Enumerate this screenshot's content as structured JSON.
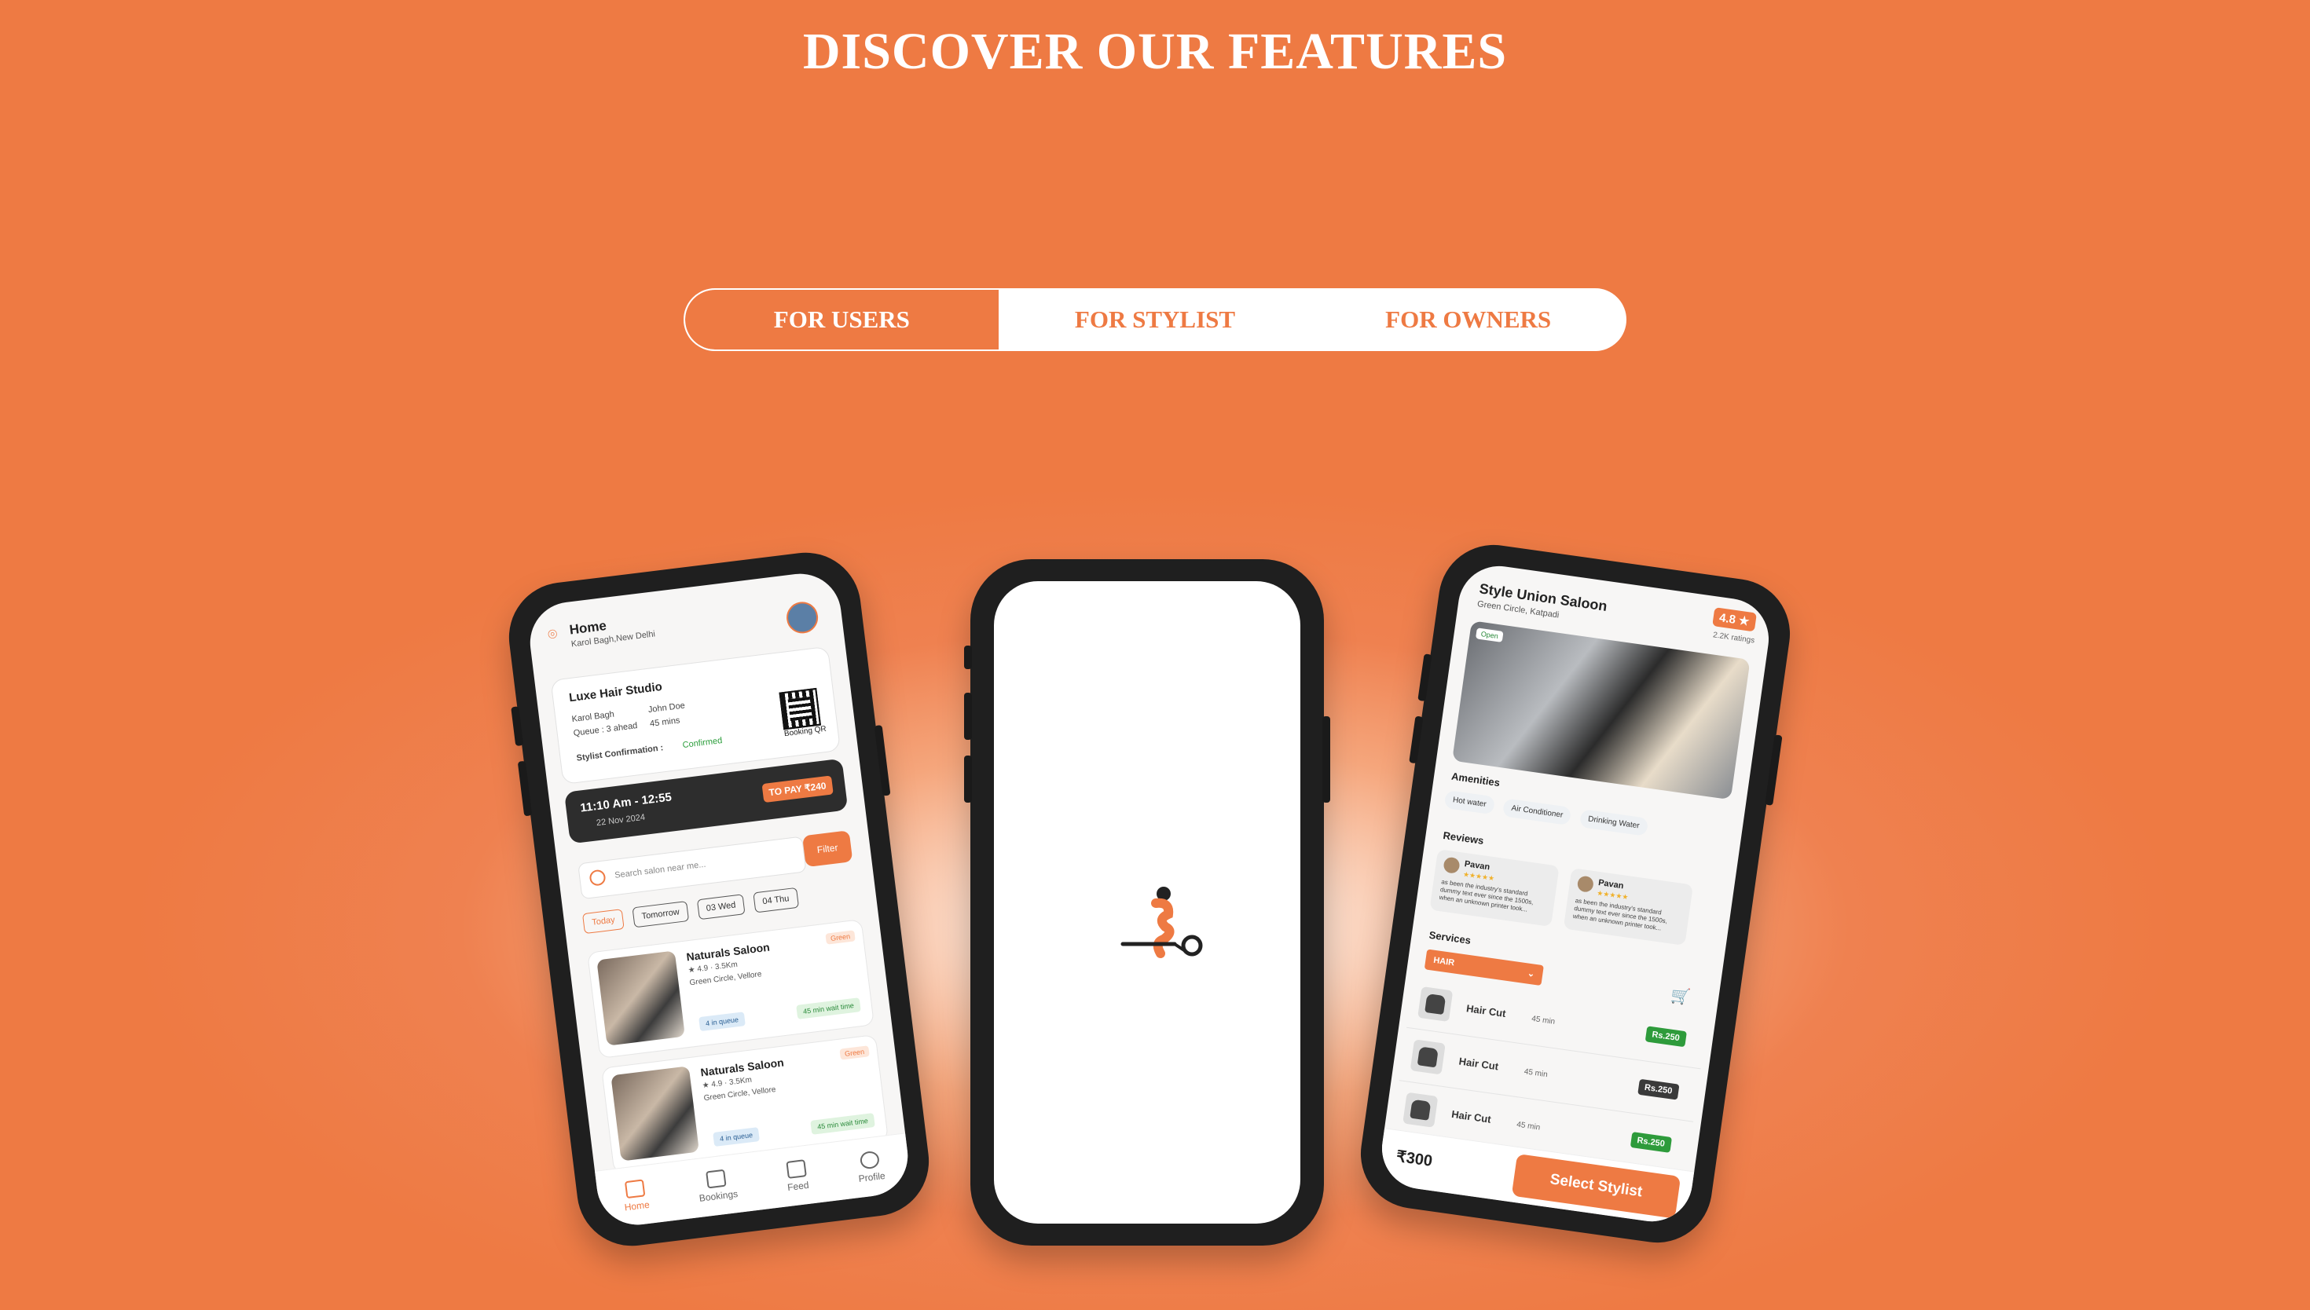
{
  "page": {
    "title": "DISCOVER OUR FEATURES"
  },
  "tabs": [
    "FOR USERS",
    "FOR STYLIST",
    "FOR OWNERS"
  ],
  "colors": {
    "accent": "#ee7a43",
    "white": "#ffffff",
    "phone": "#1f1f1f"
  },
  "left_phone": {
    "header": {
      "title": "Home",
      "location": "Karol Bagh,New Delhi"
    },
    "booking": {
      "salon": "Luxe Hair Studio",
      "area": "Karol Bagh",
      "stylist": "John Doe",
      "queue": "Queue : 3 ahead",
      "duration": "45 mins",
      "confirm_label": "Stylist Confirmation :",
      "confirm_value": "Confirmed",
      "qr_label": "Booking QR",
      "time": "11:10 Am - 12:55",
      "date": "22 Nov 2024",
      "pay": "TO PAY ₹240"
    },
    "search": {
      "placeholder": "Search salon near me...",
      "filter": "Filter"
    },
    "chips": [
      "Today",
      "Tomorrow",
      "03 Wed",
      "04 Thu"
    ],
    "salons": [
      {
        "name": "Naturals Saloon",
        "rating": "4.9",
        "distance": "3.5Km",
        "address": "Green Circle, Vellore",
        "badge": "Green",
        "queue": "4 in queue",
        "wait": "45 min wait time"
      },
      {
        "name": "Naturals Saloon",
        "rating": "4.9",
        "distance": "3.5Km",
        "address": "Green Circle, Vellore",
        "badge": "Green",
        "queue": "4 in queue",
        "wait": "45 min wait time"
      }
    ],
    "nav": [
      "Home",
      "Bookings",
      "Feed",
      "Profile"
    ]
  },
  "right_phone": {
    "title": "Style Union Saloon",
    "subtitle": "Green Circle, Katpadi",
    "rating": "4.8 ★",
    "rating_count": "2.2K ratings",
    "open": "Open",
    "amenities_title": "Amenities",
    "amenities": [
      "Hot water",
      "Air Conditioner",
      "Drinking Water"
    ],
    "reviews_title": "Reviews",
    "reviews": [
      {
        "name": "Pavan",
        "stars": "★★★★★",
        "text": "as been the industry's standard dummy text ever since the 1500s, when an unknown printer took..."
      },
      {
        "name": "Pavan",
        "stars": "★★★★★",
        "text": "as been the industry's standard dummy text ever since the 1500s, when an unknown printer took..."
      }
    ],
    "services_title": "Services",
    "category": "HAIR",
    "services": [
      {
        "name": "Hair Cut",
        "time": "45 min",
        "price": "Rs.250",
        "color": "#2e9b3b"
      },
      {
        "name": "Hair Cut",
        "time": "45 min",
        "price": "Rs.250",
        "color": "#3a3a3a"
      },
      {
        "name": "Hair Cut",
        "time": "45 min",
        "price": "Rs.250",
        "color": "#2e9b3b"
      }
    ],
    "price": "₹300",
    "cta": "Select Stylist"
  }
}
